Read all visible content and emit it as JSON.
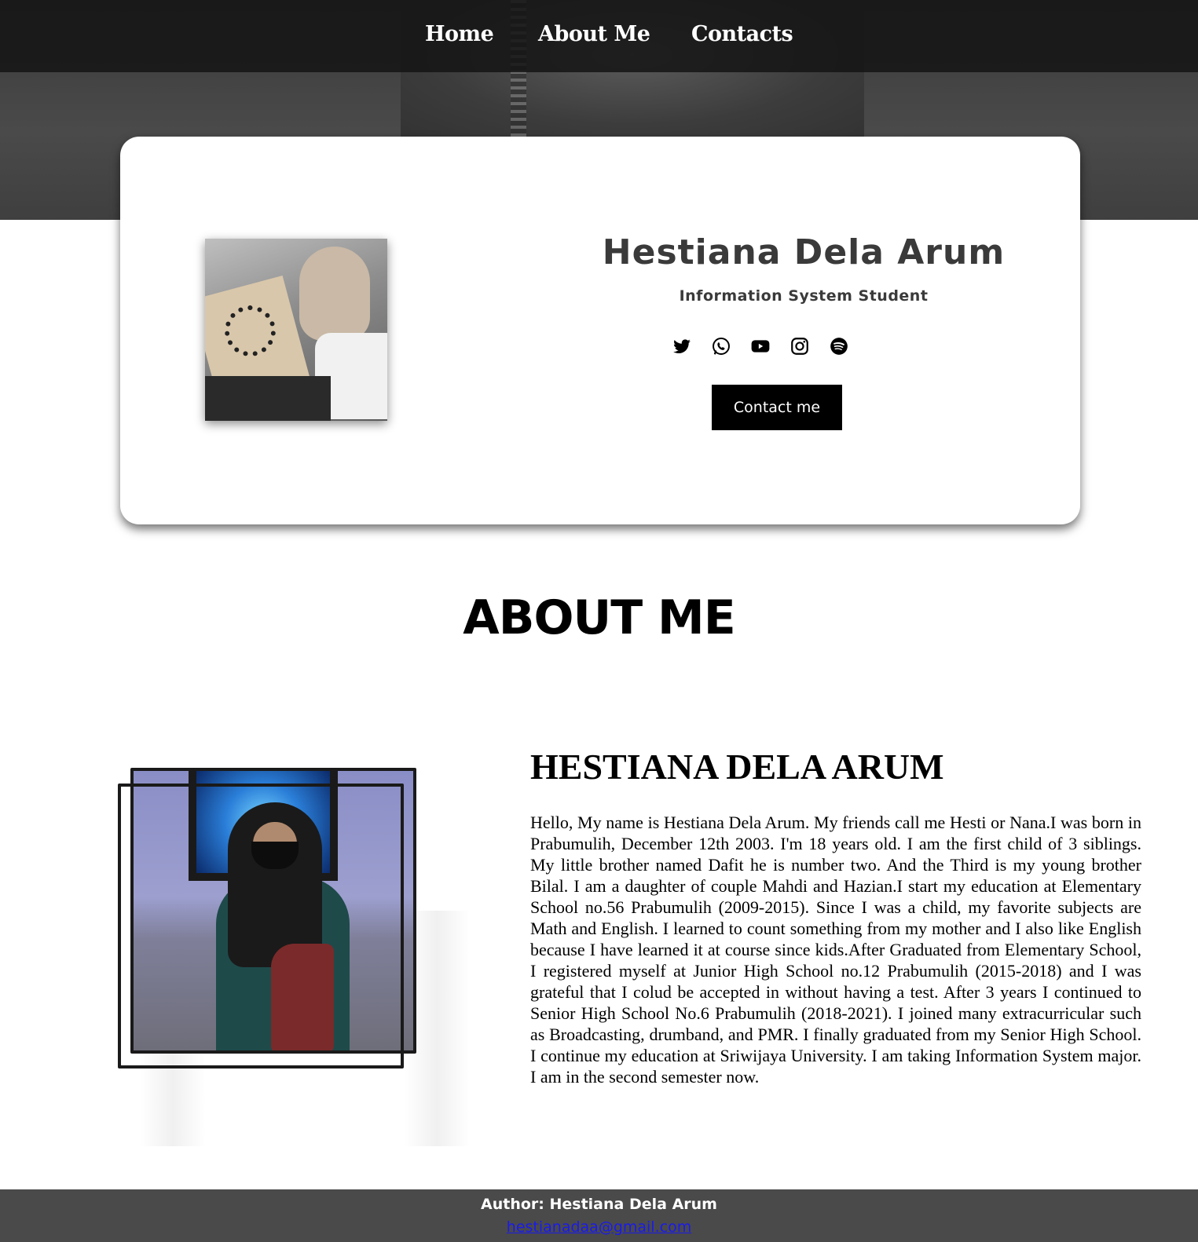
{
  "nav": {
    "home": "Home",
    "about": "About Me",
    "contacts": "Contacts"
  },
  "profile": {
    "name": "Hestiana Dela Arum",
    "subtitle": "Information System Student",
    "social_icons": [
      "twitter-icon",
      "whatsapp-icon",
      "youtube-icon",
      "instagram-icon",
      "spotify-icon"
    ],
    "contact_button": "Contact me"
  },
  "about": {
    "heading": "ABOUT ME",
    "name": "HESTIANA DELA ARUM",
    "text": "Hello, My name is Hestiana Dela Arum. My friends call me Hesti or Nana.I was born in Prabumulih, December 12th 2003. I'm 18 years old. I am the first child of 3 siblings. My little brother named Dafit he is number two. And the Third is my young brother Bilal. I am a daughter of couple Mahdi and Hazian.I start my education at Elementary School no.56 Prabumulih (2009-2015). Since I was a child, my favorite subjects are Math and English. I learned to count something from my mother and I also like English because I have learned it at course since kids.After Graduated from Elementary School, I registered myself at Junior High School no.12 Prabumulih (2015-2018) and I was grateful that I colud be accepted in without having a test. After 3 years I continued to Senior High School No.6 Prabumulih (2018-2021). I joined many extracurricular such as Broadcasting, drumband, and PMR. I finally graduated from my Senior High School. I continue my education at Sriwijaya University. I am taking Information System major. I am in the second semester now."
  },
  "footer": {
    "author": "Author: Hestiana Dela Arum",
    "email": "hestianadaa@gmail.com"
  },
  "colors": {
    "nav_bg": "#141414",
    "hero_bg": "#444444",
    "footer_bg": "#4a4a4a",
    "button_bg": "#000000",
    "link": "#1a1aee"
  }
}
